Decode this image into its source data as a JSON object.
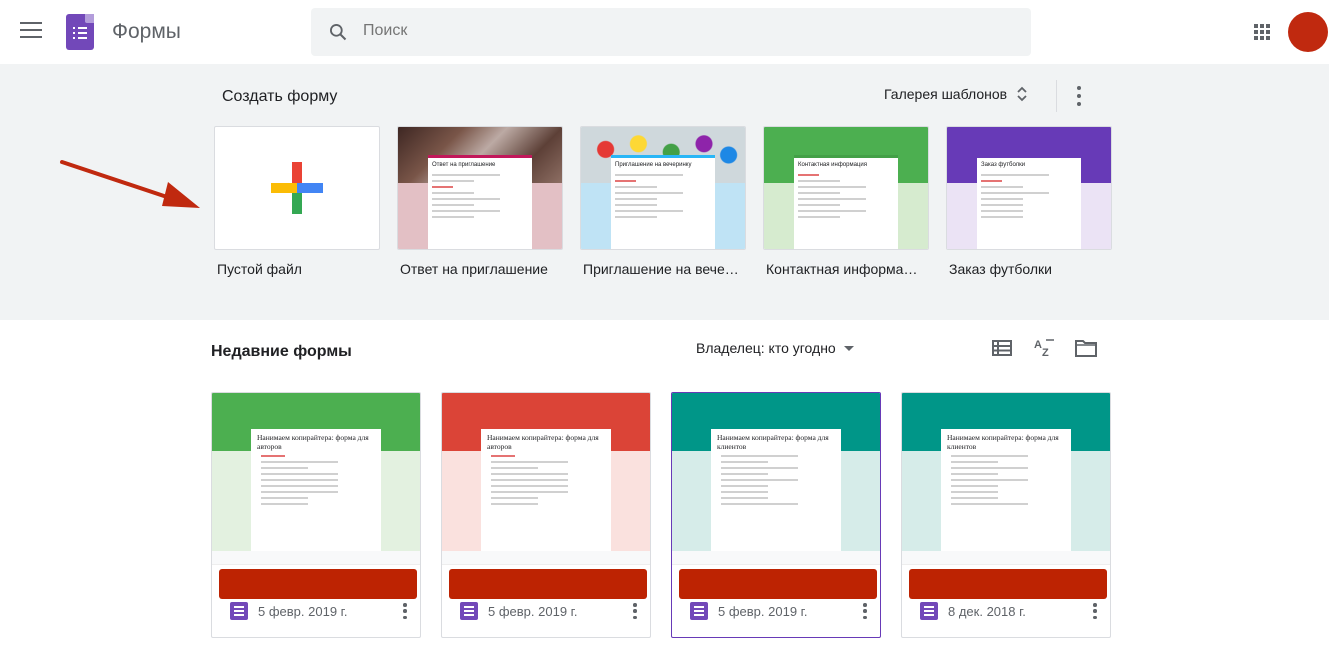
{
  "app": {
    "title": "Формы"
  },
  "search": {
    "placeholder": "Поиск"
  },
  "create": {
    "title": "Создать форму",
    "gallery_label": "Галерея шаблонов",
    "templates": [
      {
        "label": "Пустой файл",
        "paper_title": ""
      },
      {
        "label": "Ответ на приглашение",
        "paper_title": "Ответ на приглашение",
        "head_color": "#5d4037",
        "bg_color": "#e3c0c5",
        "accent": "#c2185b"
      },
      {
        "label": "Приглашение на вечеринку",
        "paper_title": "Приглашение на вечеринку",
        "head_color": "#90caf9",
        "bg_color": "#bfe3f5",
        "accent": "#29b6f6"
      },
      {
        "label": "Контактная информация",
        "paper_title": "Контактная информация",
        "head_color": "#4caf50",
        "bg_color": "#d6ebcf",
        "accent": "#43a047"
      },
      {
        "label": "Заказ футболки",
        "paper_title": "Заказ футболки",
        "head_color": "#673ab7",
        "bg_color": "#ebe3f5",
        "accent": "#673ab7"
      }
    ]
  },
  "recent": {
    "title": "Недавние формы",
    "owner_filter": "Владелец: кто угодно",
    "forms": [
      {
        "paper_title": "Нанимаем копирайтера: форма для авторов",
        "date": "5 февр. 2019 г.",
        "head_color": "#4caf50",
        "bg_color": "#e3f1e0"
      },
      {
        "paper_title": "Нанимаем копирайтера: форма для авторов",
        "date": "5 февр. 2019 г.",
        "head_color": "#db4437",
        "bg_color": "#fae1de"
      },
      {
        "paper_title": "Нанимаем копирайтера: форма для клиентов",
        "date": "5 февр. 2019 г.",
        "head_color": "#009688",
        "bg_color": "#d6ece9"
      },
      {
        "paper_title": "Нанимаем копирайтера: форма для клиентов",
        "date": "8 дек. 2018 г.",
        "head_color": "#009688",
        "bg_color": "#d6ece9"
      }
    ]
  },
  "colors": {
    "avatar": "#c0290f",
    "redaction": "#bd2302",
    "forms_brand": "#7248b9",
    "arrow": "#c0290f"
  }
}
